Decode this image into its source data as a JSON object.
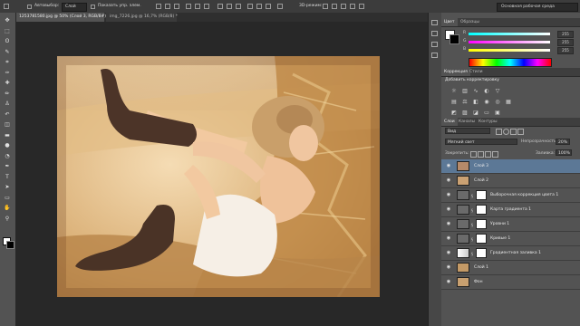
{
  "options_bar": {
    "auto_select_label": "Автовыбор:",
    "auto_select_value": "Слой",
    "show_controls_label": "Показать упр. элем.",
    "mode_3d_label": "3D-режим:",
    "workspace_label": "Основная рабочая среда"
  },
  "tabs": [
    {
      "label": "1253781580.jpg @ 50% (Слой 3, RGB/8#) *"
    },
    {
      "label": "img_7226.jpg @ 16,7% (RGB/8) *"
    }
  ],
  "color_panel": {
    "tabs": [
      "Цвет",
      "Образцы"
    ],
    "channels": [
      {
        "label": "R",
        "value": "255"
      },
      {
        "label": "G",
        "value": "255"
      },
      {
        "label": "B",
        "value": "255"
      }
    ],
    "colors": {
      "red": "#ff3030",
      "green": "#30d030",
      "blue": "#4060ff"
    }
  },
  "adjustments_panel": {
    "tabs": [
      "Коррекция",
      "Стили"
    ],
    "title": "Добавить корректировку"
  },
  "layers_panel": {
    "tabs": [
      "Слои",
      "Каналы",
      "Контуры"
    ],
    "filter_label": "Вид",
    "blend_mode": "Мягкий свет",
    "opacity_label": "Непрозрачность:",
    "opacity_value": "20%",
    "lock_label": "Закрепить:",
    "fill_label": "Заливка:",
    "fill_value": "100%",
    "layers": [
      {
        "name": "Слой 3",
        "selected": true
      },
      {
        "name": "Слой 2",
        "selected": false
      },
      {
        "name": "Выборочная коррекция цвета 1",
        "selected": false
      },
      {
        "name": "Карта градиента 1",
        "selected": false
      },
      {
        "name": "Уровни 1",
        "selected": false
      },
      {
        "name": "Кривые 1",
        "selected": false
      },
      {
        "name": "Градиентная заливка 1",
        "selected": false
      },
      {
        "name": "Слой 1",
        "selected": false
      },
      {
        "name": "Фон",
        "selected": false
      }
    ]
  },
  "tools": [
    "move-icon",
    "marquee-icon",
    "lasso-icon",
    "quick-select-icon",
    "crop-icon",
    "eyedropper-icon",
    "healing-icon",
    "brush-icon",
    "stamp-icon",
    "history-brush-icon",
    "eraser-icon",
    "gradient-icon",
    "blur-icon",
    "dodge-icon",
    "pen-icon",
    "type-icon",
    "path-select-icon",
    "shape-icon",
    "hand-icon",
    "zoom-icon"
  ]
}
